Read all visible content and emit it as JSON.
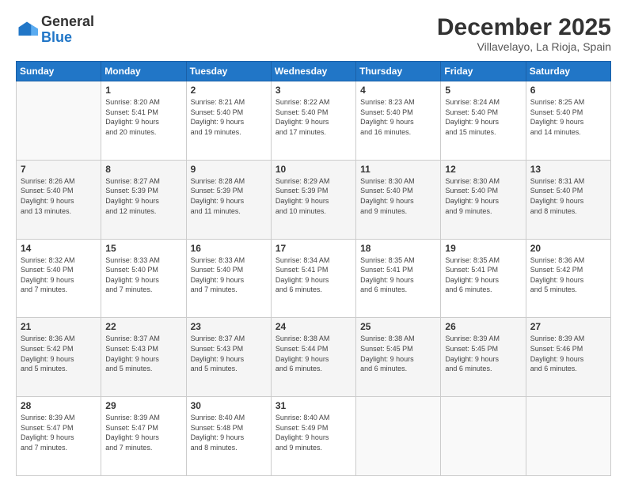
{
  "header": {
    "logo_general": "General",
    "logo_blue": "Blue",
    "month_title": "December 2025",
    "location": "Villavelayo, La Rioja, Spain"
  },
  "weekdays": [
    "Sunday",
    "Monday",
    "Tuesday",
    "Wednesday",
    "Thursday",
    "Friday",
    "Saturday"
  ],
  "weeks": [
    [
      {
        "day": "",
        "info": ""
      },
      {
        "day": "1",
        "info": "Sunrise: 8:20 AM\nSunset: 5:41 PM\nDaylight: 9 hours\nand 20 minutes."
      },
      {
        "day": "2",
        "info": "Sunrise: 8:21 AM\nSunset: 5:40 PM\nDaylight: 9 hours\nand 19 minutes."
      },
      {
        "day": "3",
        "info": "Sunrise: 8:22 AM\nSunset: 5:40 PM\nDaylight: 9 hours\nand 17 minutes."
      },
      {
        "day": "4",
        "info": "Sunrise: 8:23 AM\nSunset: 5:40 PM\nDaylight: 9 hours\nand 16 minutes."
      },
      {
        "day": "5",
        "info": "Sunrise: 8:24 AM\nSunset: 5:40 PM\nDaylight: 9 hours\nand 15 minutes."
      },
      {
        "day": "6",
        "info": "Sunrise: 8:25 AM\nSunset: 5:40 PM\nDaylight: 9 hours\nand 14 minutes."
      }
    ],
    [
      {
        "day": "7",
        "info": "Sunrise: 8:26 AM\nSunset: 5:40 PM\nDaylight: 9 hours\nand 13 minutes."
      },
      {
        "day": "8",
        "info": "Sunrise: 8:27 AM\nSunset: 5:39 PM\nDaylight: 9 hours\nand 12 minutes."
      },
      {
        "day": "9",
        "info": "Sunrise: 8:28 AM\nSunset: 5:39 PM\nDaylight: 9 hours\nand 11 minutes."
      },
      {
        "day": "10",
        "info": "Sunrise: 8:29 AM\nSunset: 5:39 PM\nDaylight: 9 hours\nand 10 minutes."
      },
      {
        "day": "11",
        "info": "Sunrise: 8:30 AM\nSunset: 5:40 PM\nDaylight: 9 hours\nand 9 minutes."
      },
      {
        "day": "12",
        "info": "Sunrise: 8:30 AM\nSunset: 5:40 PM\nDaylight: 9 hours\nand 9 minutes."
      },
      {
        "day": "13",
        "info": "Sunrise: 8:31 AM\nSunset: 5:40 PM\nDaylight: 9 hours\nand 8 minutes."
      }
    ],
    [
      {
        "day": "14",
        "info": "Sunrise: 8:32 AM\nSunset: 5:40 PM\nDaylight: 9 hours\nand 7 minutes."
      },
      {
        "day": "15",
        "info": "Sunrise: 8:33 AM\nSunset: 5:40 PM\nDaylight: 9 hours\nand 7 minutes."
      },
      {
        "day": "16",
        "info": "Sunrise: 8:33 AM\nSunset: 5:40 PM\nDaylight: 9 hours\nand 7 minutes."
      },
      {
        "day": "17",
        "info": "Sunrise: 8:34 AM\nSunset: 5:41 PM\nDaylight: 9 hours\nand 6 minutes."
      },
      {
        "day": "18",
        "info": "Sunrise: 8:35 AM\nSunset: 5:41 PM\nDaylight: 9 hours\nand 6 minutes."
      },
      {
        "day": "19",
        "info": "Sunrise: 8:35 AM\nSunset: 5:41 PM\nDaylight: 9 hours\nand 6 minutes."
      },
      {
        "day": "20",
        "info": "Sunrise: 8:36 AM\nSunset: 5:42 PM\nDaylight: 9 hours\nand 5 minutes."
      }
    ],
    [
      {
        "day": "21",
        "info": "Sunrise: 8:36 AM\nSunset: 5:42 PM\nDaylight: 9 hours\nand 5 minutes."
      },
      {
        "day": "22",
        "info": "Sunrise: 8:37 AM\nSunset: 5:43 PM\nDaylight: 9 hours\nand 5 minutes."
      },
      {
        "day": "23",
        "info": "Sunrise: 8:37 AM\nSunset: 5:43 PM\nDaylight: 9 hours\nand 5 minutes."
      },
      {
        "day": "24",
        "info": "Sunrise: 8:38 AM\nSunset: 5:44 PM\nDaylight: 9 hours\nand 6 minutes."
      },
      {
        "day": "25",
        "info": "Sunrise: 8:38 AM\nSunset: 5:45 PM\nDaylight: 9 hours\nand 6 minutes."
      },
      {
        "day": "26",
        "info": "Sunrise: 8:39 AM\nSunset: 5:45 PM\nDaylight: 9 hours\nand 6 minutes."
      },
      {
        "day": "27",
        "info": "Sunrise: 8:39 AM\nSunset: 5:46 PM\nDaylight: 9 hours\nand 6 minutes."
      }
    ],
    [
      {
        "day": "28",
        "info": "Sunrise: 8:39 AM\nSunset: 5:47 PM\nDaylight: 9 hours\nand 7 minutes."
      },
      {
        "day": "29",
        "info": "Sunrise: 8:39 AM\nSunset: 5:47 PM\nDaylight: 9 hours\nand 7 minutes."
      },
      {
        "day": "30",
        "info": "Sunrise: 8:40 AM\nSunset: 5:48 PM\nDaylight: 9 hours\nand 8 minutes."
      },
      {
        "day": "31",
        "info": "Sunrise: 8:40 AM\nSunset: 5:49 PM\nDaylight: 9 hours\nand 9 minutes."
      },
      {
        "day": "",
        "info": ""
      },
      {
        "day": "",
        "info": ""
      },
      {
        "day": "",
        "info": ""
      }
    ]
  ]
}
